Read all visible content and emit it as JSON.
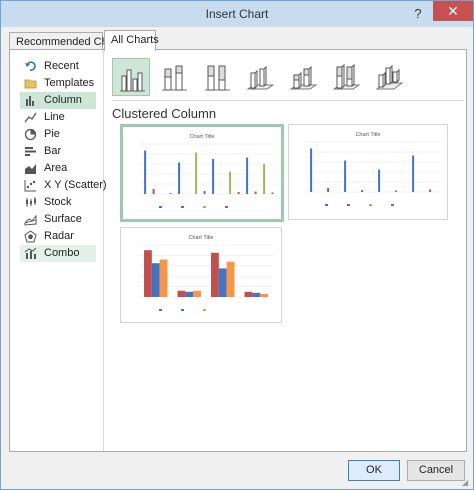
{
  "window": {
    "title": "Insert Chart",
    "help_label": "?",
    "close_label": "✕"
  },
  "tabs": [
    {
      "label": "Recommended Charts"
    },
    {
      "label": "All Charts"
    }
  ],
  "sidebar": {
    "selected": "Column",
    "items": [
      {
        "label": "Recent",
        "icon": "undo-arrow-icon"
      },
      {
        "label": "Templates",
        "icon": "folder-icon"
      },
      {
        "label": "Column",
        "icon": "column-chart-icon"
      },
      {
        "label": "Line",
        "icon": "line-chart-icon"
      },
      {
        "label": "Pie",
        "icon": "pie-chart-icon"
      },
      {
        "label": "Bar",
        "icon": "bar-chart-icon"
      },
      {
        "label": "Area",
        "icon": "area-chart-icon"
      },
      {
        "label": "X Y (Scatter)",
        "icon": "scatter-chart-icon"
      },
      {
        "label": "Stock",
        "icon": "stock-chart-icon"
      },
      {
        "label": "Surface",
        "icon": "surface-chart-icon"
      },
      {
        "label": "Radar",
        "icon": "radar-chart-icon"
      },
      {
        "label": "Combo",
        "icon": "combo-chart-icon"
      }
    ]
  },
  "chart_types": {
    "selected_index": 0,
    "subtitle": "Clustered Column",
    "items": [
      {
        "icon": "clustered-column-icon"
      },
      {
        "icon": "stacked-column-icon"
      },
      {
        "icon": "100-stacked-column-icon"
      },
      {
        "icon": "3d-clustered-column-icon"
      },
      {
        "icon": "3d-stacked-column-icon"
      },
      {
        "icon": "3d-100-stacked-column-icon"
      },
      {
        "icon": "3d-column-icon"
      }
    ]
  },
  "previews": [
    {
      "title": "Chart Title"
    },
    {
      "title": "Chart Title"
    },
    {
      "title": "Chart Title"
    }
  ],
  "colors": {
    "selection": "#cde6d8",
    "selection_border": "#9fc8ae",
    "series_blue": "#4472c4",
    "series_red": "#c0504d",
    "series_green": "#9bbb59",
    "series_purple": "#8064a2",
    "series_orange": "#f79646"
  },
  "buttons": {
    "ok": "OK",
    "cancel": "Cancel"
  }
}
